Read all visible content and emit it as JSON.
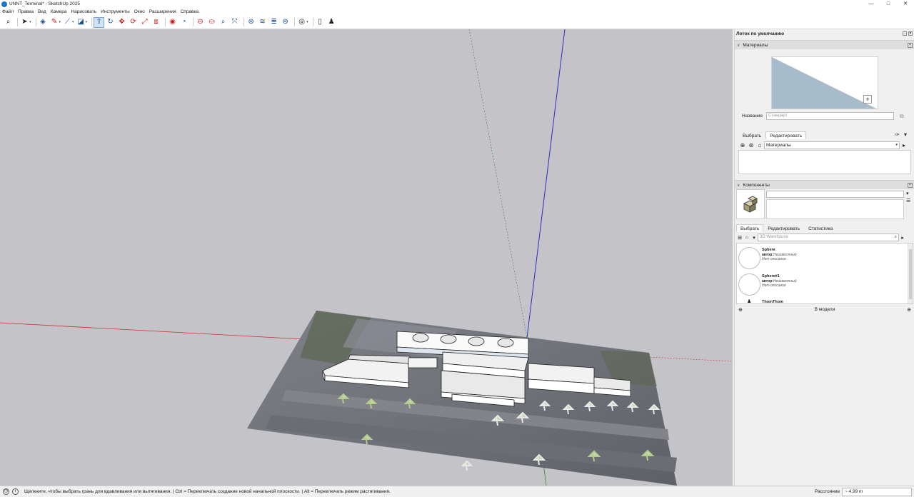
{
  "window": {
    "title": "UNNT_Terminal* - SketchUp 2025",
    "controls": [
      "—",
      "□",
      "✕"
    ]
  },
  "menu": [
    "Файл",
    "Правка",
    "Вид",
    "Камера",
    "Нарисовать",
    "Инструменты",
    "Окно",
    "Расширения",
    "Справка"
  ],
  "toolbar": {
    "icons": [
      "search-icon",
      "select-arrow-icon",
      "eraser-icon",
      "pencil-icon",
      "line-icon",
      "shape-icon",
      "push-pull-icon",
      "follow-me-icon",
      "move-icon",
      "rotate-icon",
      "scale-icon",
      "offset-icon",
      "tape-measure-icon",
      "protractor-icon",
      "section-icon",
      "paint-bucket-icon",
      "orbit-icon",
      "zoom-icon",
      "zoom-extents-icon",
      "warehouse-icon",
      "extension-icon",
      "layers-icon",
      "profile-icon",
      "document-icon",
      "user-icon"
    ]
  },
  "tray": {
    "title": "Лоток по умолчанию",
    "materials": {
      "header": "Материалы",
      "name_label": "Название",
      "name_placeholder": "Стандарт",
      "tab_select": "Выбрать",
      "tab_edit": "Редактировать",
      "collection": "Материалы",
      "preview_color": "#a7bccb"
    },
    "components": {
      "header": "Компоненты",
      "tab_select": "Выбрать",
      "tab_edit": "Редактировать",
      "tab_stats": "Статистика",
      "search_placeholder": "3D Warehouse",
      "items": [
        {
          "name": "Sphere",
          "author_label": "автор:",
          "author": "Неизвестный",
          "desc": "Нет описания"
        },
        {
          "name": "Sphere#1",
          "author_label": "автор:",
          "author": "Неизвестный",
          "desc": "Нет описания"
        },
        {
          "name": "ThomThom",
          "author_label": "",
          "author": "",
          "desc": ""
        }
      ],
      "in_model": "В модели"
    }
  },
  "status": {
    "message": "Щелкните, чтобы выбрать грань для вдавливания или вытягивания. | Ctrl = Переключать создание новой начальной плоскости. | Alt = Переключать режим растягивания.",
    "vcb_label": "Расстояние",
    "vcb_value": "~ 4,99 m"
  },
  "colors": {
    "viewport_bg": "#c4c4c8",
    "axis_red": "#c43030",
    "axis_green": "#3a8a3a",
    "axis_blue": "#2c2cc0",
    "accent": "#1e74c7"
  }
}
